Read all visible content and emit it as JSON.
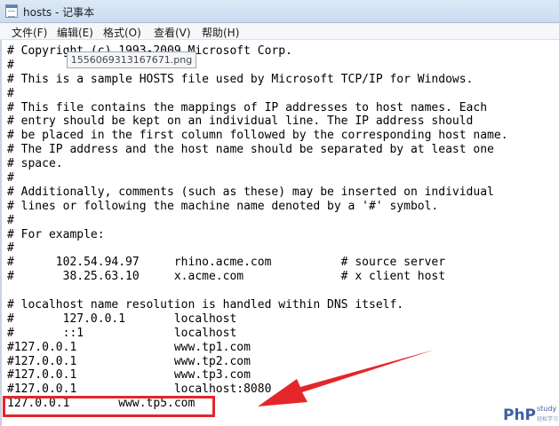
{
  "window": {
    "title": "hosts - 记事本"
  },
  "menu": {
    "items": [
      {
        "label": "文件(F)"
      },
      {
        "label": "编辑(E)"
      },
      {
        "label": "格式(O)"
      },
      {
        "label": "查看(V)"
      },
      {
        "label": "帮助(H)"
      }
    ]
  },
  "tooltip": {
    "text": "1556069313167671.png"
  },
  "editor": {
    "lines": [
      "# Copyright (c) 1993-2009 Microsoft Corp.",
      "#",
      "# This is a sample HOSTS file used by Microsoft TCP/IP for Windows.",
      "#",
      "# This file contains the mappings of IP addresses to host names. Each",
      "# entry should be kept on an individual line. The IP address should",
      "# be placed in the first column followed by the corresponding host name.",
      "# The IP address and the host name should be separated by at least one",
      "# space.",
      "#",
      "# Additionally, comments (such as these) may be inserted on individual",
      "# lines or following the machine name denoted by a '#' symbol.",
      "#",
      "# For example:",
      "#",
      "#      102.54.94.97     rhino.acme.com          # source server",
      "#       38.25.63.10     x.acme.com              # x client host",
      "",
      "# localhost name resolution is handled within DNS itself.",
      "#\t127.0.0.1       localhost",
      "#\t::1             localhost",
      "#127.0.0.1\t\twww.tp1.com",
      "#127.0.0.1\t\twww.tp2.com",
      "#127.0.0.1\t\twww.tp3.com",
      "#127.0.0.1\t\tlocalhost:8080",
      "127.0.0.1\twww.tp5.com"
    ]
  },
  "annotation": {
    "box_color": "#e4262a",
    "arrow_color": "#e4262a"
  },
  "logo": {
    "php": "PhP",
    "study": "study",
    "sub": "轻松学习"
  }
}
